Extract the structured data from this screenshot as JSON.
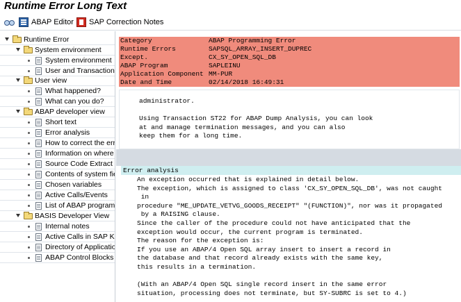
{
  "window": {
    "title": "Runtime Error Long Text"
  },
  "toolbar": {
    "display_icon": "glasses-icon",
    "abap_editor_label": "ABAP Editor",
    "sap_notes_label": "SAP Correction Notes"
  },
  "tree": {
    "root": "Runtime Error",
    "groups": [
      {
        "label": "System environment",
        "items": [
          "System environment",
          "User and Transaction"
        ]
      },
      {
        "label": "User view",
        "items": [
          "What happened?",
          "What can you do?"
        ]
      },
      {
        "label": "ABAP developer view",
        "items": [
          "Short text",
          "Error analysis",
          "How to correct the err",
          "Information on where t",
          "Source Code Extract",
          "Contents of system fiel",
          "Chosen variables",
          "Active Calls/Events",
          "List of ABAP programs a"
        ]
      },
      {
        "label": "BASIS Developer View",
        "items": [
          "Internal notes",
          "Active Calls in SAP Kern",
          "Directory of Application",
          "ABAP Control Blocks (C"
        ]
      }
    ]
  },
  "properties": [
    {
      "key": "Category",
      "value": "ABAP Programming Error"
    },
    {
      "key": "Runtime Errors",
      "value": "SAPSQL_ARRAY_INSERT_DUPREC"
    },
    {
      "key": "Except.",
      "value": "CX_SY_OPEN_SQL_DB"
    },
    {
      "key": "ABAP Program",
      "value": "SAPLEINU"
    },
    {
      "key": "Application Component",
      "value": "MM-PUR"
    },
    {
      "key": "Date and Time",
      "value": "02/14/2018 16:49:31"
    }
  ],
  "what_can_you_do_tail": [
    "administrator.",
    "",
    "Using Transaction ST22 for ABAP Dump Analysis, you can look",
    "at and manage termination messages, and you can also",
    "keep them for a long time."
  ],
  "error_analysis": {
    "heading": "Error analysis",
    "lines": [
      "An exception occurred that is explained in detail below.",
      "The exception, which is assigned to class 'CX_SY_OPEN_SQL_DB', was not caught",
      " in",
      "procedure \"ME_UPDATE_VETVG_GOODS_RECEIPT\" \"(FUNCTION)\", nor was it propagated",
      " by a RAISING clause.",
      "Since the caller of the procedure could not have anticipated that the",
      "exception would occur, the current program is terminated.",
      "The reason for the exception is:",
      "If you use an ABAP/4 Open SQL array insert to insert a record in",
      "the database and that record already exists with the same key,",
      "this results in a termination.",
      "",
      "(With an ABAP/4 Open SQL single record insert in the same error",
      "situation, processing does not terminate, but SY-SUBRC is set to 4.)"
    ]
  }
}
